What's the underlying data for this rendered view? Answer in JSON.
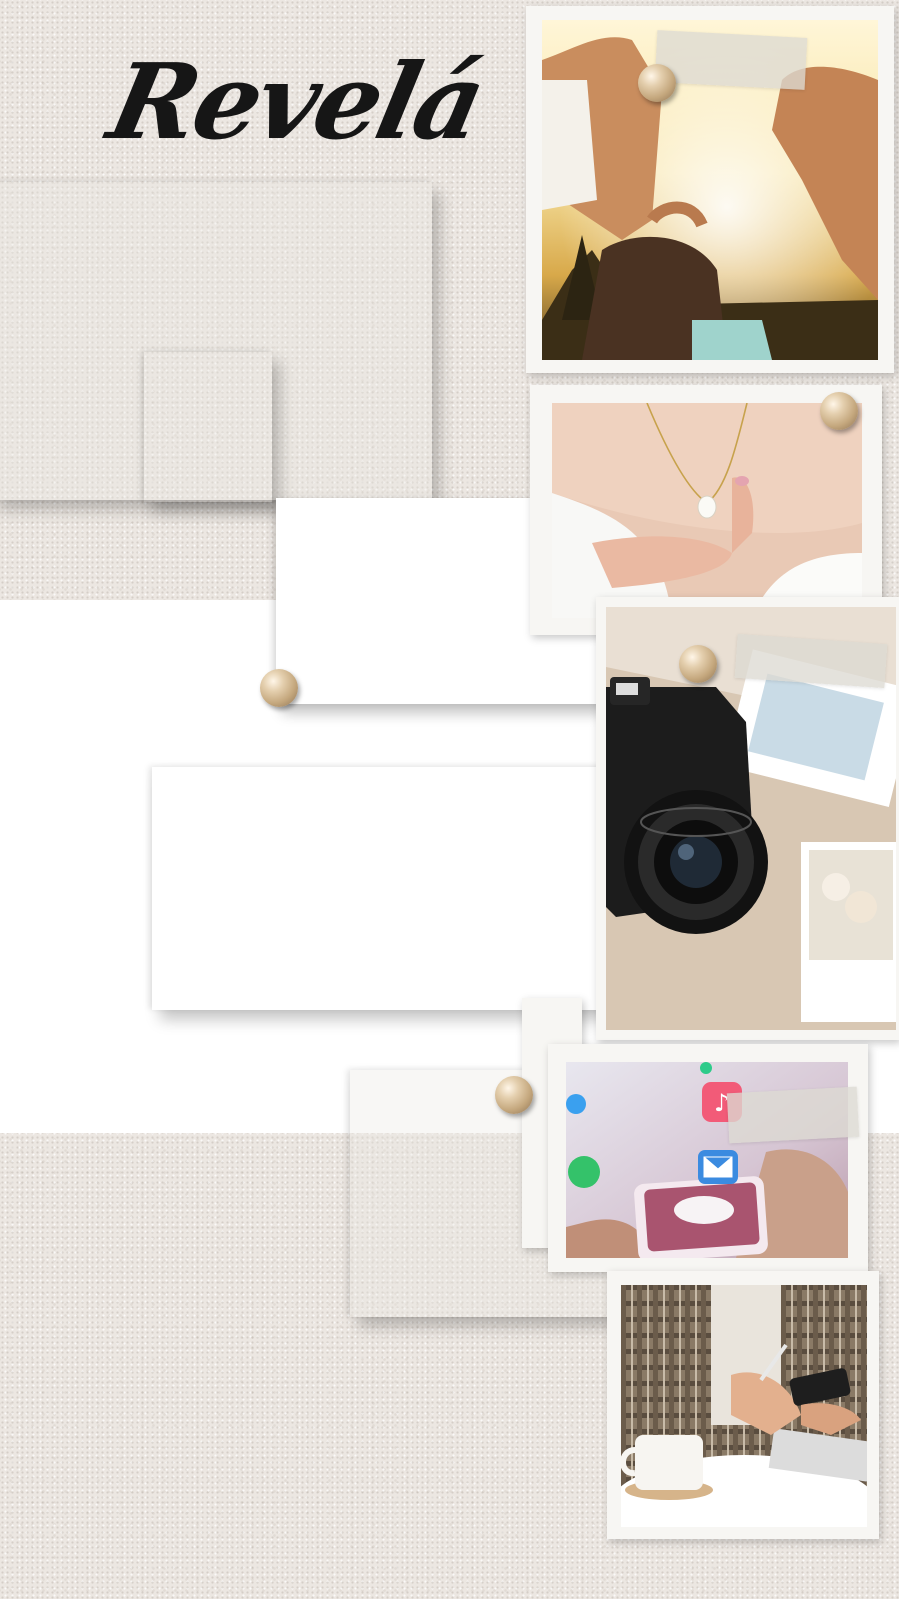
{
  "title": "Revelá",
  "colors": {
    "background": "#ece7e2",
    "band": "#ffffff",
    "title": "#161616",
    "pin": "#c4a77d"
  },
  "photos": [
    {
      "name": "friends-heart-hands-photo",
      "subject": "heart-hands-sunset"
    },
    {
      "name": "necklace-photo",
      "subject": "pearl-necklace"
    },
    {
      "name": "camera-photo",
      "subject": "dslr-camera-with-prints"
    },
    {
      "name": "smartphone-apps-photo",
      "subject": "phone-app-icons"
    },
    {
      "name": "phone-coffee-photo",
      "subject": "person-phone-coffee"
    }
  ],
  "icons": [
    "music-note-icon",
    "mail-icon",
    "thumbtack-pin-icon",
    "masking-tape"
  ]
}
